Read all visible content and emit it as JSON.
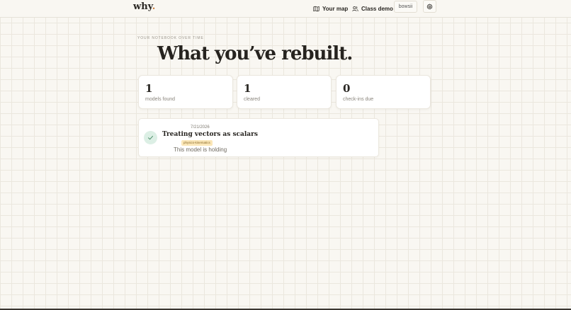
{
  "header": {
    "logo": "why",
    "logo_dot": ".",
    "nav": [
      {
        "label": "Your map",
        "icon": "map-icon"
      },
      {
        "label": "Class demo",
        "icon": "users-icon"
      }
    ],
    "user": "bowsii",
    "settings_icon": "gear-icon"
  },
  "main": {
    "eyebrow": "YOUR NOTEBOOK OVER TIME",
    "title": "What you’ve rebuilt.",
    "stats": [
      {
        "value": "1",
        "label": "models found"
      },
      {
        "value": "1",
        "label": "cleared"
      },
      {
        "value": "0",
        "label": "check-ins due"
      }
    ],
    "models": [
      {
        "date": "7/21/2026",
        "title": "Treating vectors as scalars",
        "tag": "physics-kinematics",
        "status": "This model is holding",
        "icon": "check-icon"
      }
    ]
  },
  "colors": {
    "accent": "#c97a3a",
    "success_bg": "#dcefe5",
    "success": "#4e8f6a",
    "tag_bg": "#fbe7b8"
  }
}
